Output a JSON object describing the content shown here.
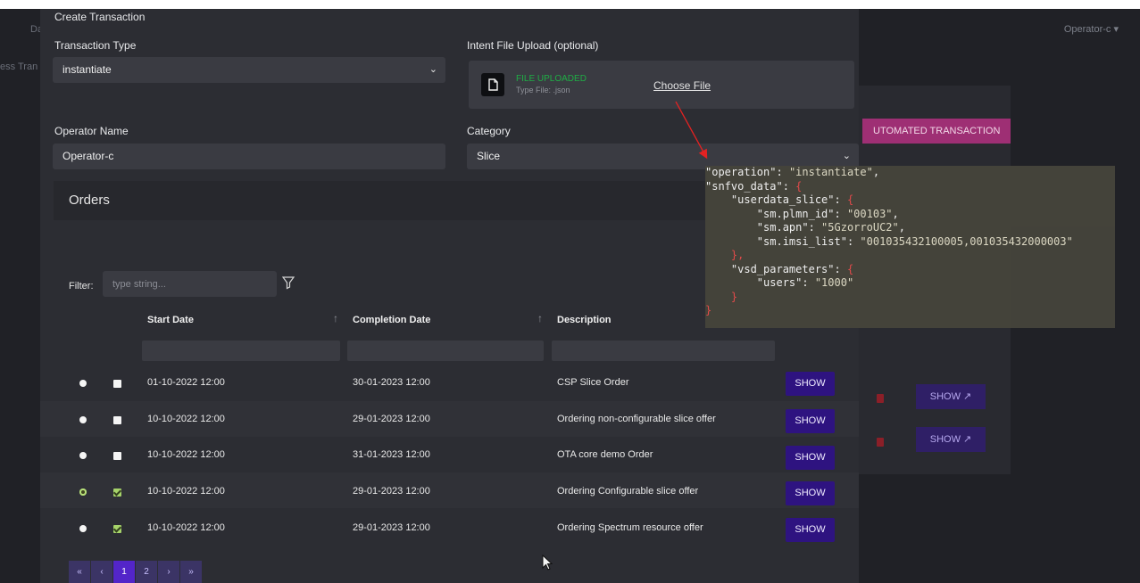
{
  "background": {
    "nav_dash": "Das",
    "nav_tran": "ess Tran",
    "user_menu": "Operator-c",
    "automated_btn": "UTOMATED TRANSACTION",
    "show_labels": [
      "SHOW",
      "SHOW"
    ]
  },
  "modal": {
    "title": "Create Transaction",
    "transaction_type": {
      "label": "Transaction Type",
      "value": "instantiate"
    },
    "intent_upload": {
      "label": "Intent File Upload (optional)",
      "status": "FILE UPLOADED",
      "type_text": "Type File: .json",
      "choose_label": "Choose File"
    },
    "operator_name": {
      "label": "Operator Name",
      "value": "Operator-c"
    },
    "category": {
      "label": "Category",
      "value": "Slice"
    },
    "orders": {
      "title": "Orders",
      "filter_label": "Filter:",
      "filter_placeholder": "type string...",
      "columns": [
        "Start Date",
        "Completion Date",
        "Description"
      ],
      "show_label": "SHOW",
      "rows": [
        {
          "start": "01-10-2022 12:00",
          "end": "30-01-2023 12:00",
          "desc": "CSP Slice Order",
          "radio_selected": false,
          "checked": false
        },
        {
          "start": "10-10-2022 12:00",
          "end": "29-01-2023 12:00",
          "desc": "Ordering non-configurable slice offer",
          "radio_selected": false,
          "checked": false
        },
        {
          "start": "10-10-2022 12:00",
          "end": "31-01-2023 12:00",
          "desc": "OTA core demo Order",
          "radio_selected": false,
          "checked": false
        },
        {
          "start": "10-10-2022 12:00",
          "end": "29-01-2023 12:00",
          "desc": "Ordering Configurable slice offer",
          "radio_selected": true,
          "checked": true
        },
        {
          "start": "10-10-2022 12:00",
          "end": "29-01-2023 12:00",
          "desc": "Ordering Spectrum resource offer",
          "radio_selected": false,
          "checked": true
        }
      ],
      "pagination": [
        "«",
        "‹",
        "1",
        "2",
        "›",
        "»"
      ]
    }
  },
  "json_overlay": {
    "operation_key": "\"operation\"",
    "operation_val": "\"instantiate\"",
    "snfvo_key": "\"snfvo_data\"",
    "userdata_key": "\"userdata_slice\"",
    "plmn_key": "\"sm.plmn_id\"",
    "plmn_val": "\"00103\"",
    "apn_key": "\"sm.apn\"",
    "apn_val": "\"5GzorroUC2\"",
    "imsi_key": "\"sm.imsi_list\"",
    "imsi_val": "\"001035432100005,001035432000003\"",
    "vsd_key": "\"vsd_parameters\"",
    "users_key": "\"users\"",
    "users_val": "\"1000\""
  },
  "colors": {
    "accent": "#2e1380",
    "pink": "#9e2f74",
    "uploaded": "#1fae45",
    "arrow": "#e32222"
  }
}
